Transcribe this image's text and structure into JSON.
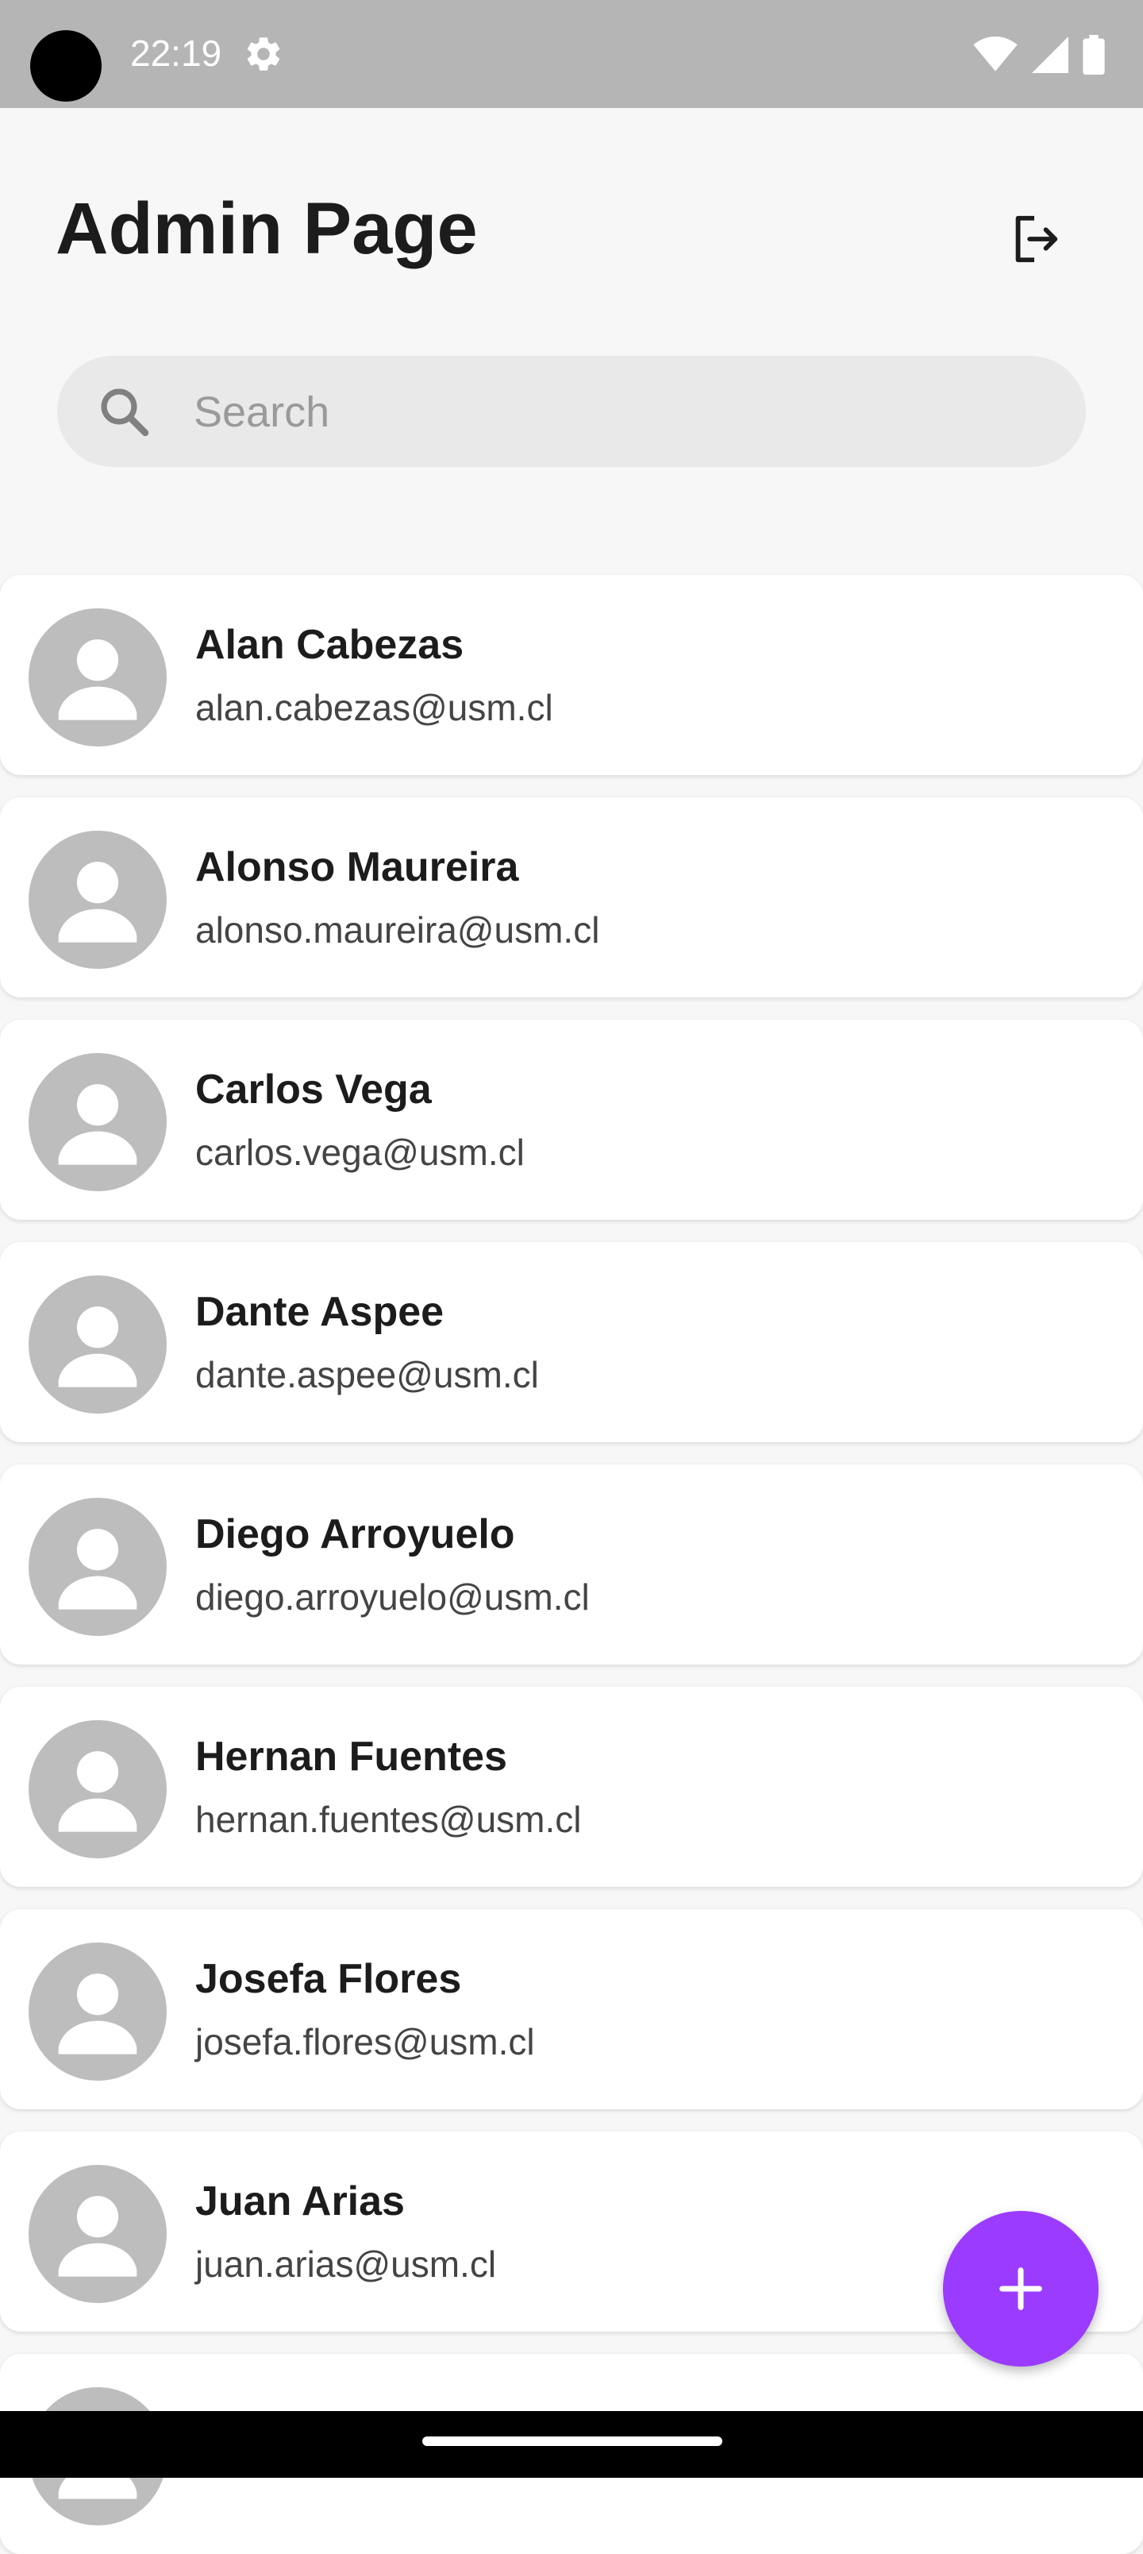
{
  "status_bar": {
    "time": "22:19",
    "icons": [
      "camera-cutout",
      "settings-gear-icon",
      "wifi-icon",
      "signal-icon",
      "battery-icon"
    ]
  },
  "header": {
    "title": "Admin Page",
    "logout_icon": "logout-icon"
  },
  "search": {
    "placeholder": "Search",
    "value": ""
  },
  "users": [
    {
      "name": "Alan Cabezas",
      "email": "alan.cabezas@usm.cl"
    },
    {
      "name": "Alonso Maureira",
      "email": "alonso.maureira@usm.cl"
    },
    {
      "name": "Carlos Vega",
      "email": "carlos.vega@usm.cl"
    },
    {
      "name": "Dante Aspee",
      "email": "dante.aspee@usm.cl"
    },
    {
      "name": "Diego Arroyuelo",
      "email": "diego.arroyuelo@usm.cl"
    },
    {
      "name": "Hernan Fuentes",
      "email": "hernan.fuentes@usm.cl"
    },
    {
      "name": "Josefa Flores",
      "email": "josefa.flores@usm.cl"
    },
    {
      "name": "Juan Arias",
      "email": "juan.arias@usm.cl"
    }
  ],
  "fab": {
    "icon": "plus-icon"
  },
  "colors": {
    "accent": "#9b3bff",
    "status_bar": "#b5b5b5",
    "background": "#f7f7f7",
    "avatar": "#bdbdbd"
  }
}
